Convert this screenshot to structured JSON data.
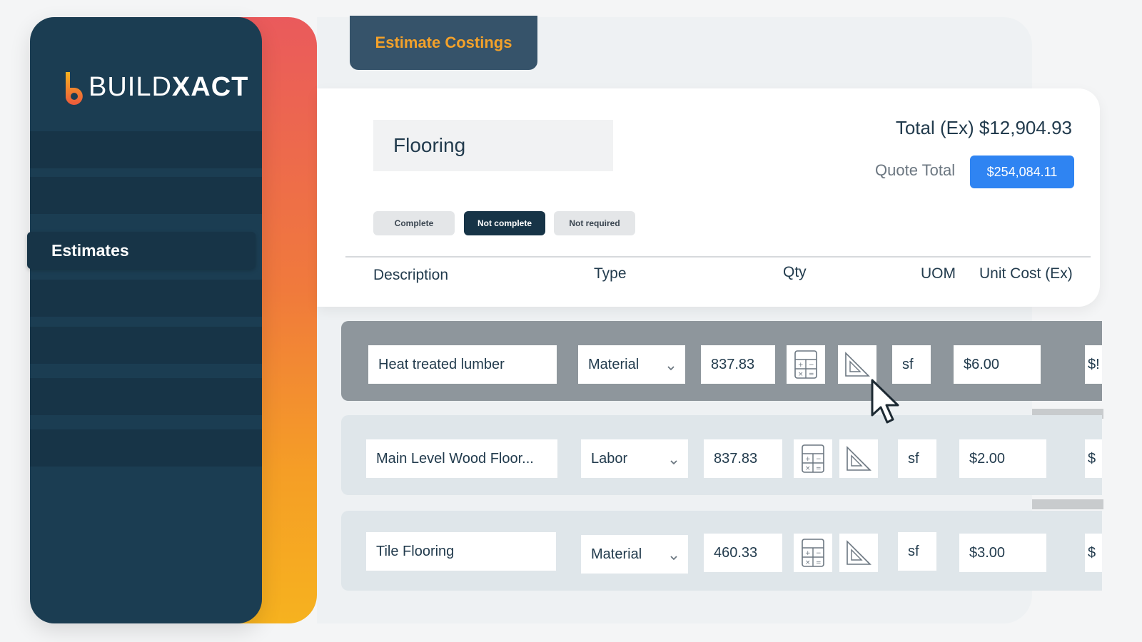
{
  "app": {
    "logo_text_light": "BUILD",
    "logo_text_bold": "XACT",
    "logo_icon": "buildxact-b-logo-icon"
  },
  "sidebar": {
    "active_item": "Estimates"
  },
  "tab": {
    "label": "Estimate Costings"
  },
  "estimate": {
    "section_title": "Flooring",
    "total_ex": "Total (Ex) $12,904.93",
    "quote_total_label": "Quote Total",
    "quote_total_value": "$254,084.11"
  },
  "status_filters": [
    {
      "label": "Complete",
      "selected": false
    },
    {
      "label": "Not complete",
      "selected": true
    },
    {
      "label": "Not required",
      "selected": false
    }
  ],
  "table": {
    "columns": [
      "Description",
      "Type",
      "Qty",
      "UOM",
      "Unit Cost (Ex)"
    ],
    "rows": [
      {
        "description": "Heat treated lumber",
        "type": "Material",
        "qty": "837.83",
        "uom": "sf",
        "unit_cost": "$6.00",
        "clipped": "$!"
      },
      {
        "description": "Main Level Wood Floor...",
        "type": "Labor",
        "qty": "837.83",
        "uom": "sf",
        "unit_cost": "$2.00",
        "clipped": "$"
      },
      {
        "description": "Tile Flooring",
        "type": "Material",
        "qty": "460.33",
        "uom": "sf",
        "unit_cost": "$3.00",
        "clipped": "$"
      }
    ]
  },
  "icons": {
    "calculator": "calculator-icon",
    "measure": "set-square-icon",
    "dropdown": "chevron-down-icon",
    "cursor": "mouse-pointer-icon"
  },
  "colors": {
    "sidebar": "#1b3d52",
    "accent_orange": "#f3a12a",
    "primary_blue": "#2f84f2",
    "active_row": "#8e969c",
    "row_bg": "#dfe6ea"
  }
}
